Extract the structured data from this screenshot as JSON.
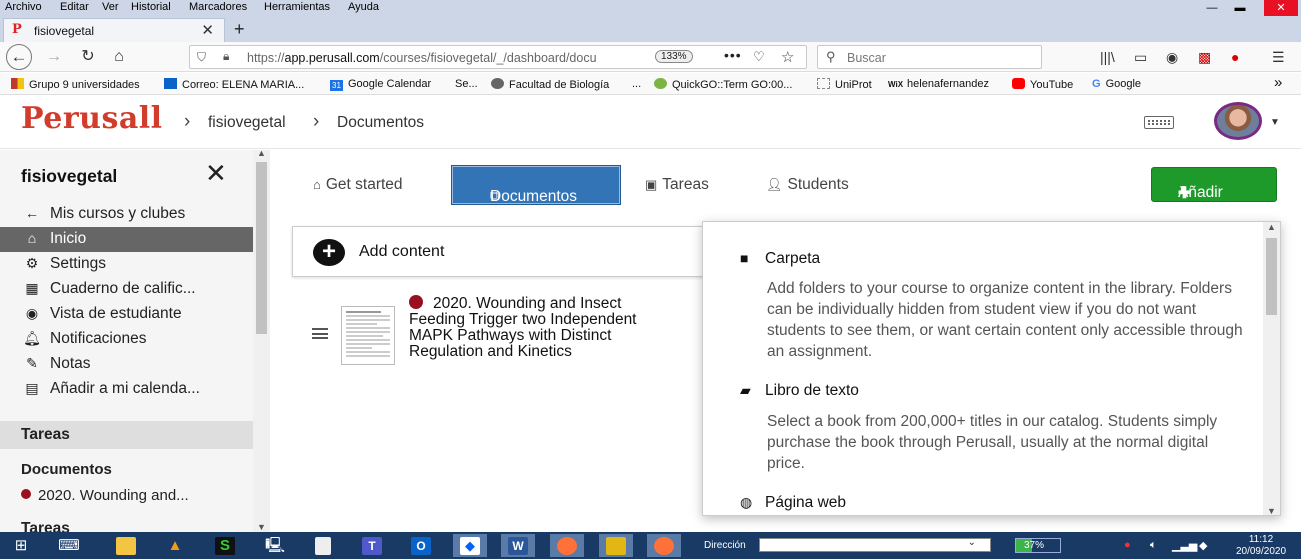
{
  "menubar": {
    "items": [
      "Archivo",
      "Editar",
      "Ver",
      "Historial",
      "Marcadores",
      "Herramientas",
      "Ayuda"
    ],
    "window_controls": [
      "—",
      "▬",
      "✕"
    ]
  },
  "browser": {
    "tab_title": "fisiovegetal",
    "url_host": "app.perusall.com",
    "url_prefix": "https://",
    "url_path": "/courses/fisiovegetal/_/dashboard/docu",
    "zoom": "133%",
    "search_placeholder": "Buscar"
  },
  "bookmarks": [
    {
      "label": "Grupo 9 universidades",
      "color": "#c0392b"
    },
    {
      "label": "Correo: ELENA MARIA...",
      "color": "#0a63c9"
    },
    {
      "label": "Google Calendar",
      "color": "#1a73e8",
      "badge": "31"
    },
    {
      "label": "Se...",
      "color": ""
    },
    {
      "label": "Facultad de Biología",
      "color": "#666"
    },
    {
      "label": "...",
      "color": ""
    },
    {
      "label": "QuickGO::Term GO:00...",
      "color": "#7cb342"
    },
    {
      "label": "UniProt",
      "color": "#888"
    },
    {
      "label": "helenafernandez",
      "color": "#333",
      "badge": "WiX"
    },
    {
      "label": "YouTube",
      "color": "#ff0000"
    },
    {
      "label": "Google",
      "color": "#4285f4"
    }
  ],
  "header": {
    "logo": "Perusall",
    "breadcrumb": [
      "fisiovegetal",
      "Documentos"
    ]
  },
  "sidebar": {
    "title": "fisiovegetal",
    "items": [
      {
        "label": "Mis cursos y clubes",
        "icon": "arrow-left-icon"
      },
      {
        "label": "Inicio",
        "icon": "home-icon",
        "active": true
      },
      {
        "label": "Settings",
        "icon": "gear-icon"
      },
      {
        "label": "Cuaderno de calific...",
        "icon": "table-icon"
      },
      {
        "label": "Vista de estudiante",
        "icon": "eye-icon"
      },
      {
        "label": "Notificaciones",
        "icon": "bell-icon"
      },
      {
        "label": "Notas",
        "icon": "pencil-icon"
      },
      {
        "label": "Añadir a mi calenda...",
        "icon": "calendar-icon"
      }
    ],
    "section_tareas": "Tareas",
    "sub_documentos": "Documentos",
    "doc_item": "2020. Wounding and...",
    "section_tareas2": "Tareas"
  },
  "main": {
    "tabs": [
      {
        "label": "Get started",
        "icon": "home-icon"
      },
      {
        "label": "Documentos",
        "icon": "copy-icon",
        "active": true
      },
      {
        "label": "Tareas",
        "icon": "calendar-check-icon"
      },
      {
        "label": "Students",
        "icon": "user-icon"
      }
    ],
    "add_button": "Añadir",
    "add_content": "Add content",
    "document": {
      "title": "2020. Wounding and Insect Feeding Trigger two Independent MAPK Pathways with Distinct Regulation and Kinetics",
      "status_color": "#9a1020"
    }
  },
  "dropdown": {
    "items": [
      {
        "title": "Carpeta",
        "icon": "folder-icon",
        "desc": "Add folders to your course to organize content in the library. Folders can be individually hidden from student view if you do not want students to see them, or want certain content only accessible through an assignment."
      },
      {
        "title": "Libro de texto",
        "icon": "book-icon",
        "desc": "Select a book from 200,000+ titles in our catalog. Students simply purchase the book through Perusall, usually at the normal digital price."
      },
      {
        "title": "Página web",
        "icon": "globe-icon",
        "desc": ""
      }
    ]
  },
  "taskbar": {
    "address_label": "Dirección",
    "battery": "37%",
    "battery_level": 0.37,
    "time": "11:12",
    "date": "20/09/2020"
  },
  "colors": {
    "brand": "#d23c2c",
    "active_tab": "#3374b6",
    "add_button": "#1e9a2b",
    "sidebar_active": "#666666"
  }
}
